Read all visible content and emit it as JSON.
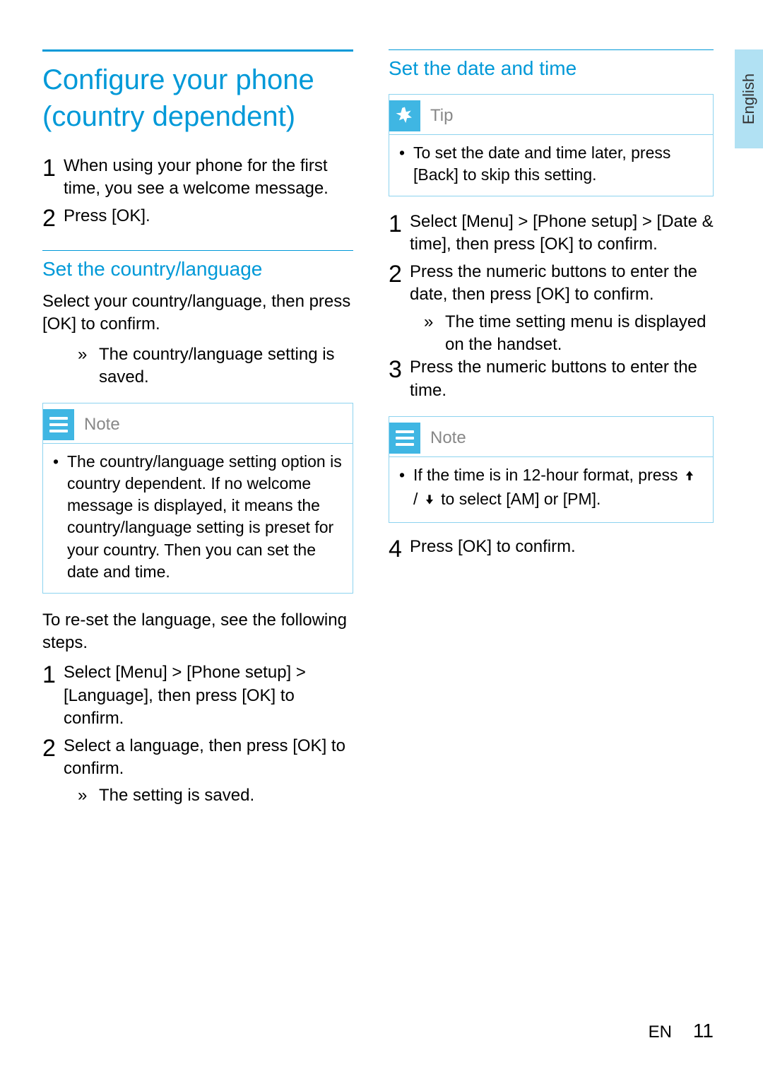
{
  "lang_tab": "English",
  "left": {
    "title": "Configure your phone (country dependent)",
    "intro_steps": [
      "When using your phone for the first time, you see a welcome message.",
      "Press [OK]."
    ],
    "sub1_title": "Set the country/language",
    "sub1_body": "Select your country/language, then press [OK] to confirm.",
    "sub1_result": "The country/language setting is saved.",
    "note_label": "Note",
    "note_text": "The country/language setting option is country dependent. If no welcome message is displayed, it means the country/language setting is preset for your country. Then you can set the date and time.",
    "reset_intro": "To re-set the language, see the following steps.",
    "reset_steps": [
      "Select [Menu] > [Phone setup] > [Language], then press [OK] to confirm.",
      "Select a language, then press [OK] to confirm."
    ],
    "reset_result": "The setting is saved."
  },
  "right": {
    "title": "Set the date and time",
    "tip_label": "Tip",
    "tip_text": "To set the date and time later, press [Back] to skip this setting.",
    "steps": [
      "Select [Menu] > [Phone setup] > [Date & time], then press [OK] to confirm.",
      "Press the numeric buttons to enter the date, then press [OK] to confirm.",
      "Press the numeric buttons to enter the time."
    ],
    "step2_result": "The time setting menu is displayed on the handset.",
    "note_label": "Note",
    "note_text_pre": "If the time is in 12-hour format, press ",
    "note_text_post": " to select [AM] or [PM].",
    "step4": "Press [OK] to confirm."
  },
  "footer": {
    "lang": "EN",
    "page": "11"
  }
}
